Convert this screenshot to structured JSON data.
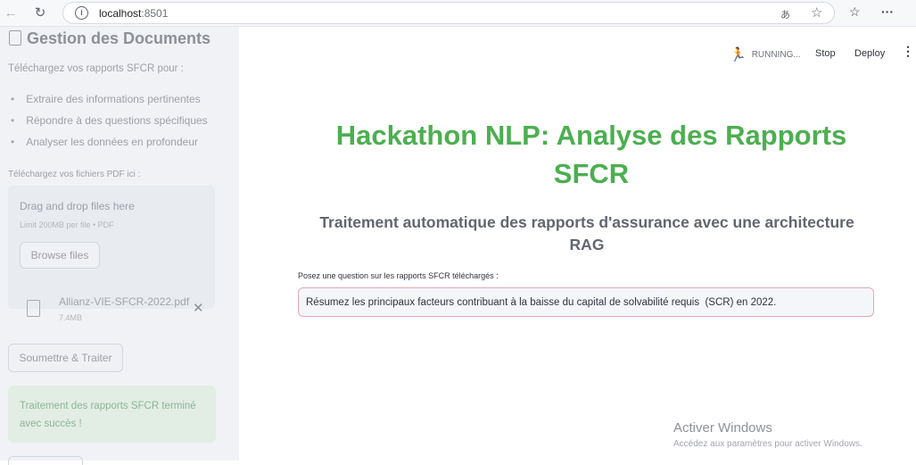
{
  "browser": {
    "url_host": "localhost",
    "url_port": ":8501",
    "back_glyph": "←",
    "reload_glyph": "↻",
    "reader_glyph": "あ",
    "star_glyph": "☆",
    "favorites_glyph": "☆",
    "menu_glyph": "···"
  },
  "sidebar": {
    "title": "Gestion des Documents",
    "intro": "Téléchargez vos rapports SFCR pour :",
    "bullets": [
      "Extraire des informations pertinentes",
      "Répondre à des questions spécifiques",
      "Analyser les données en profondeur"
    ],
    "upload_label": "Téléchargez vos fichiers PDF ici :",
    "dropzone": {
      "title": "Drag and drop files here",
      "limit": "Limit 200MB per file • PDF",
      "browse_label": "Browse files"
    },
    "file": {
      "name": "Allianz-VIE-SFCR-2022.pdf",
      "size": "7.4MB",
      "remove_glyph": "✕"
    },
    "submit_label": "Soumettre & Traiter",
    "success_message": "Traitement des rapports SFCR terminé avec succès !"
  },
  "header": {
    "status": "RUNNING...",
    "runner_glyph": "🏃",
    "stop_label": "Stop",
    "deploy_label": "Deploy",
    "menu_glyph": "⋮"
  },
  "main": {
    "title": "Hackathon NLP: Analyse des Rapports SFCR",
    "subtitle": "Traitement automatique des rapports d'assurance avec une architecture RAG",
    "question_label": "Posez une question sur les rapports SFCR téléchargés :",
    "question_value": "Résumez les principaux facteurs contribuant à la baisse du capital de solvabilité requis  (SCR) en 2022."
  },
  "watermark": {
    "title": "Activer Windows",
    "subtitle": "Accédez aux paramètres pour activer Windows."
  },
  "colors": {
    "title_green": "#4caf50",
    "sidebar_bg": "#f0f2f6",
    "input_border": "#e1a8b3",
    "success_bg": "#e2ede4"
  }
}
